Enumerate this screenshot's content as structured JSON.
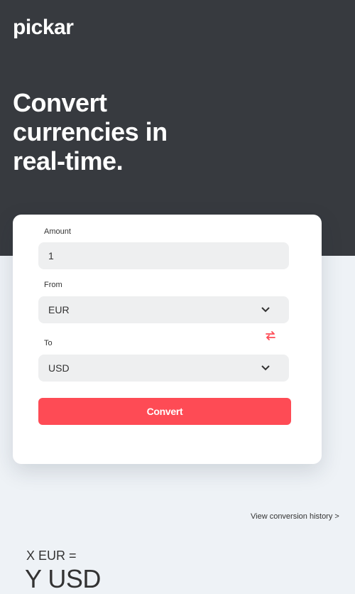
{
  "brand": {
    "logo": "pickar"
  },
  "hero": {
    "headline": "Convert currencies in real-time."
  },
  "form": {
    "amount_label": "Amount",
    "amount_value": "1",
    "from_label": "From",
    "from_value": "EUR",
    "to_label": "To",
    "to_value": "USD",
    "convert_label": "Convert"
  },
  "links": {
    "history": "View conversion history >"
  },
  "result": {
    "from_line": "X EUR =",
    "to_line": "Y USD"
  },
  "colors": {
    "hero_bg": "#373a3f",
    "accent": "#fe4b55",
    "page_bg": "#eef2f6"
  },
  "icons": {
    "select_arrow": "chevron-down-icon",
    "swap": "swap-arrows-icon"
  }
}
